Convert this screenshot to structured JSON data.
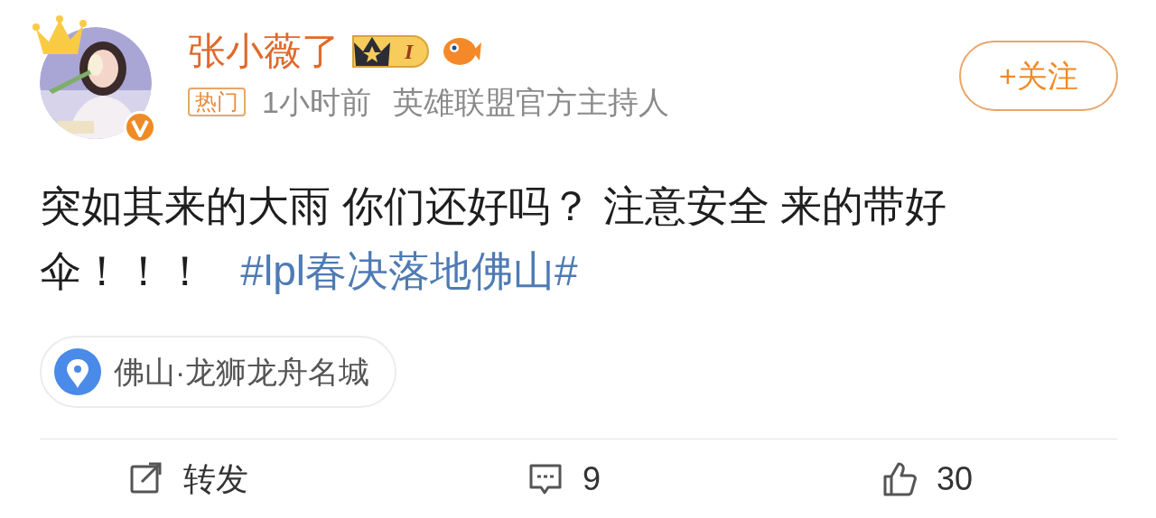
{
  "author": {
    "name": "张小薇了",
    "verified": true,
    "member_level": "I",
    "tag": "热门",
    "time": "1小时前",
    "description": "英雄联盟官方主持人"
  },
  "follow_button": {
    "label": "+关注"
  },
  "post": {
    "text": "突如其来的大雨 你们还好吗？ 注意安全 来的带好伞！！！",
    "hashtag": "#lpl春决落地佛山#"
  },
  "location": {
    "label": "佛山·龙狮龙舟名城"
  },
  "actions": [
    {
      "kind": "repost",
      "label": "转发"
    },
    {
      "kind": "comment",
      "label": "9"
    },
    {
      "kind": "like",
      "label": "30"
    }
  ]
}
